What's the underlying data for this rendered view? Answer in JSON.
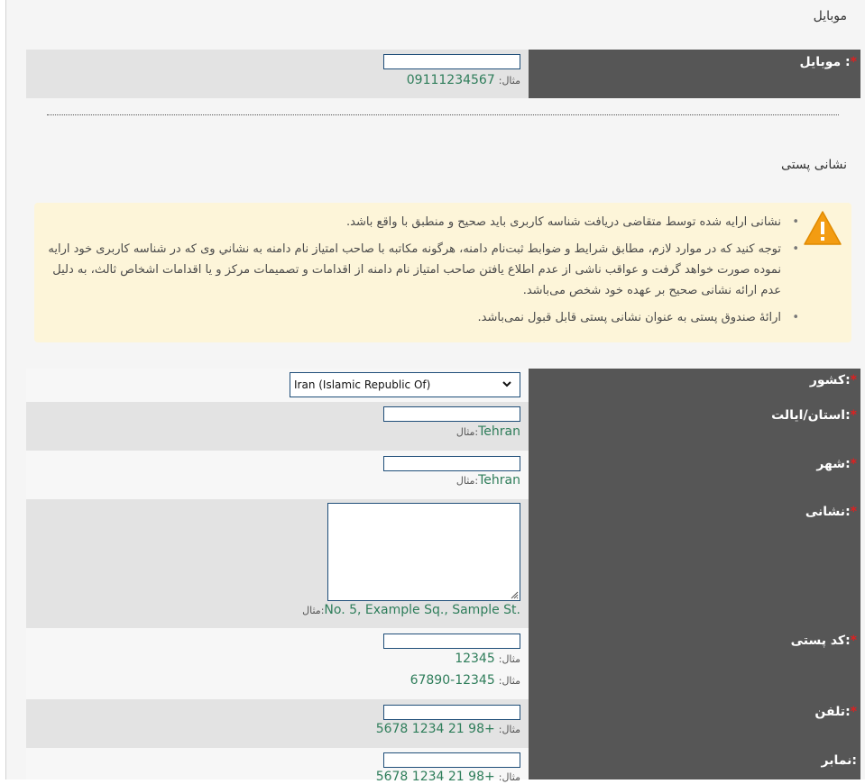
{
  "mobile_section": {
    "title": "موبایل"
  },
  "mobile": {
    "label": "موبایل :",
    "required": "*",
    "example_label": "مثال:",
    "example": "09111234567"
  },
  "postal_section": {
    "title": "نشانی پستی"
  },
  "notice": {
    "icon": "warning-icon",
    "items": [
      "نشانی ارایه شده توسط متقاضی دریافت شناسه کاربری باید صحیح و منطبق با واقع باشد.",
      "توجه کنید که در موارد لازم، مطابق شرایط و ضوابط ثبت‌نام دامنه، هرگونه مکاتبه با صاحب امتیاز نام دامنه به نشاني وی که در شناسه کاربری خود ارایه نموده صورت خواهد گرفت و عواقب ناشی از عدم اطلاع یافتن صاحب امتیاز نام دامنه از اقدامات و تصمیمات مرکز و یا اقدامات اشخاص ثالث، به دلیل عدم ارائه نشانی صحیح بر عهده خود شخص می‌باشد.",
      "ارائۀ صندوق پستی به عنوان نشانی پستی قابل قبول نمی‌باشد."
    ]
  },
  "country": {
    "label": "کشور:",
    "required": "*",
    "selected": "Iran (Islamic Republic Of)"
  },
  "province": {
    "label": "استان/ایالت:",
    "required": "*",
    "example_label": "مثال:",
    "example": "Tehran"
  },
  "city": {
    "label": "شهر:",
    "required": "*",
    "example_label": "مثال:",
    "example": "Tehran"
  },
  "address": {
    "label": "نشانی:",
    "required": "*",
    "example_label": "مثال:",
    "example": "No. 5, Example Sq., Sample St."
  },
  "postal_code": {
    "label": "کد پستی:",
    "required": "*",
    "example_label": "مثال:",
    "example1": "12345",
    "example2": "12345-67890"
  },
  "phone": {
    "label": "تلفن:",
    "required": "*",
    "example_label": "مثال:",
    "example": "+98 21 1234 5678"
  },
  "fax": {
    "label": "نمابر:",
    "example_label": "مثال:",
    "example": "+98 21 1234 5678"
  },
  "colors": {
    "label_bg": "#565656",
    "required": "#e02020",
    "hint": "#2e7d5a",
    "notice_bg": "#fdf5d9",
    "input_border": "#1f4e79"
  }
}
